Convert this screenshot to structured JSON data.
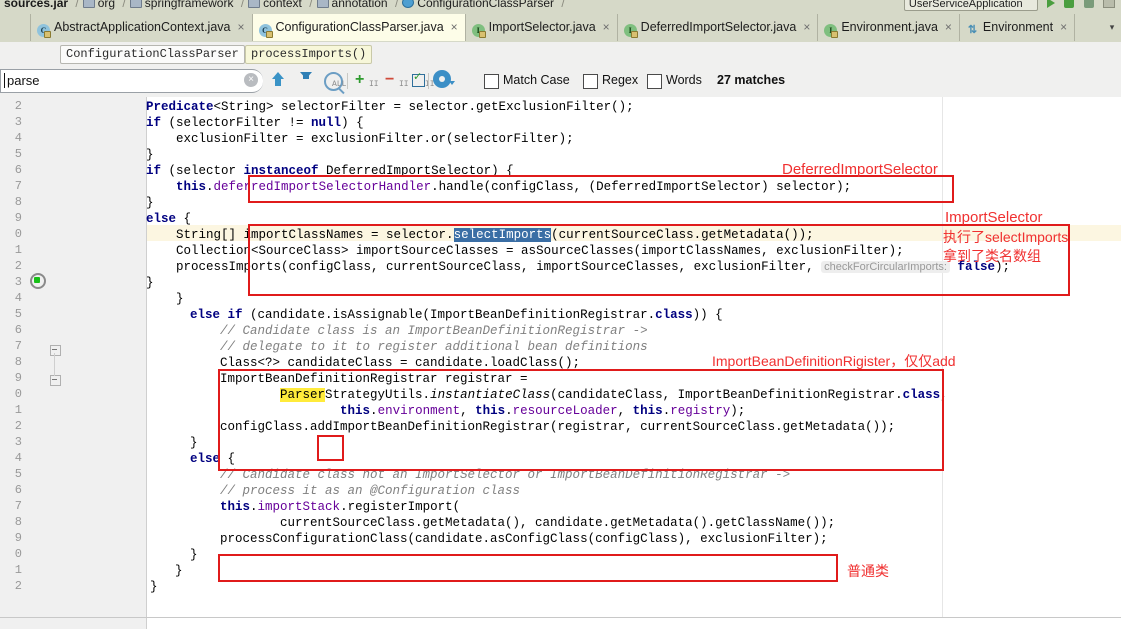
{
  "window": {
    "breadcrumb": {
      "jar": "sources.jar",
      "items": [
        "org",
        "springframework",
        "context",
        "annotation",
        "ConfigurationClassParser"
      ],
      "separator": "/"
    },
    "run_config": "UserServiceApplication",
    "toolbar_icons": [
      "run-icon",
      "debug-icon",
      "coverage-icon",
      "stop-icon"
    ]
  },
  "tabs": [
    {
      "label": "AbstractApplicationContext.java",
      "icon": "class-icon",
      "active": false,
      "close": "×"
    },
    {
      "label": "ConfigurationClassParser.java",
      "icon": "class-icon",
      "active": true,
      "close": "×"
    },
    {
      "label": "ImportSelector.java",
      "icon": "interface-icon",
      "active": false,
      "close": "×"
    },
    {
      "label": "DeferredImportSelector.java",
      "icon": "interface-icon",
      "active": false,
      "close": "×"
    },
    {
      "label": "Environment.java",
      "icon": "interface-icon",
      "active": false,
      "close": "×"
    },
    {
      "label": "Environment",
      "icon": "diagram-icon",
      "active": false,
      "close": "×"
    }
  ],
  "tab_overflow": "▾",
  "member_bar": {
    "class_chip": "ConfigurationClassParser",
    "method_chip": "processImports()"
  },
  "find": {
    "query": "parse",
    "clear_icon": "×",
    "prev_label": "prev-match",
    "next_label": "next-match",
    "find_all_label": "find-all",
    "add_selection_label": "add-selection",
    "remove_selection_label": "remove-selection",
    "select_all_occurrences_label": "select-all-occurrences",
    "settings_label": "find-settings",
    "match_case": {
      "label": "Match Case",
      "checked": false
    },
    "regex": {
      "label": "Regex",
      "checked": false
    },
    "words": {
      "label": "Words",
      "checked": false
    },
    "match_count": "27 matches"
  },
  "editor": {
    "line_numbers": [
      "2",
      "3",
      "4",
      "5",
      "6",
      "7",
      "8",
      "9",
      "0",
      "1",
      "2",
      "3",
      "4",
      "5",
      "6",
      "7",
      "8",
      "9",
      "0",
      "1",
      "2",
      "3",
      "4",
      "5",
      "6",
      "7",
      "8",
      "9",
      "0",
      "1",
      "2"
    ],
    "lines": [
      "            Predicate<String> selectorFilter = selector.getExclusionFilter();",
      "            if (selectorFilter != null) {",
      "                exclusionFilter = exclusionFilter.or(selectorFilter);",
      "            }",
      "            if (selector instanceof DeferredImportSelector) {",
      "                this.deferredImportSelectorHandler.handle(configClass, (DeferredImportSelector) selector);",
      "            }",
      "            else {",
      "                String[] importClassNames = selector.selectImports(currentSourceClass.getMetadata());",
      "                Collection<SourceClass> importSourceClasses = asSourceClasses(importClassNames, exclusionFilter);",
      "                processImports(configClass, currentSourceClass, importSourceClasses, exclusionFilter,  checkForCircularImports: false);",
      "            }",
      "        }",
      "        else if (candidate.isAssignable(ImportBeanDefinitionRegistrar.class)) {",
      "            // Candidate class is an ImportBeanDefinitionRegistrar ->",
      "            // delegate to it to register additional bean definitions",
      "            Class<?> candidateClass = candidate.loadClass();",
      "            ImportBeanDefinitionRegistrar registrar =",
      "                    ParserStrategyUtils.instantiateClass(candidateClass, ImportBeanDefinitionRegistrar.class,",
      "                            this.environment, this.resourceLoader, this.registry);",
      "            configClass.addImportBeanDefinitionRegistrar(registrar, currentSourceClass.getMetadata());",
      "        }",
      "        else {",
      "            // Candidate class not an ImportSelector or ImportBeanDefinitionRegistrar ->",
      "            // process it as an @Configuration class",
      "            this.importStack.registerImport(",
      "                    currentSourceClass.getMetadata(), candidate.getMetadata().getClassName());",
      "            processConfigurationClass(candidate.asConfigClass(configClass), exclusionFilter);",
      "        }",
      "    }",
      "}"
    ],
    "selected_text": "selectImports",
    "highlighted_text": "Parser",
    "inlay_hint": "checkForCircularImports:",
    "run_gutter_icon": "run-method-icon"
  },
  "annotations": [
    {
      "text": "DeferredImportSelector",
      "name": "annotation-deferred-import-selector"
    },
    {
      "text": "ImportSelector",
      "name": "annotation-import-selector"
    },
    {
      "text": "执行了selectImports",
      "name": "annotation-executed-selectimports"
    },
    {
      "text": "拿到了类名数组",
      "name": "annotation-got-classname-array"
    },
    {
      "text": "ImportBeanDefinitionRigister，仅仅add",
      "name": "annotation-import-bean-definition-register"
    },
    {
      "text": "普通类",
      "name": "annotation-plain-class"
    }
  ],
  "colors": {
    "annotation_red": "#e01b1b",
    "keyword_blue": "#000080",
    "field_purple": "#660099",
    "comment_gray": "#808080",
    "selection_blue": "#3a6ea5",
    "highlight_yellow": "#ffeb3b",
    "caret_line": "#fcf6e1",
    "tab_bar": "#d6d9c8",
    "active_tab": "#fdfde8"
  }
}
